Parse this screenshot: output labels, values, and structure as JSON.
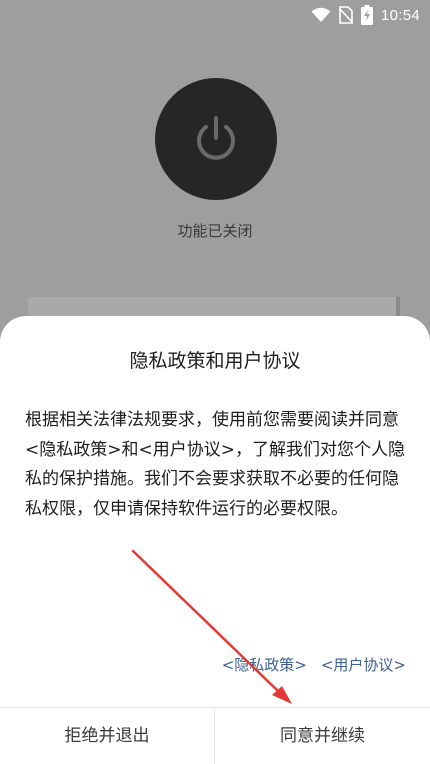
{
  "status_bar": {
    "time": "10:54"
  },
  "app": {
    "status_text": "功能已关闭",
    "icons": {
      "power": "power-icon"
    }
  },
  "dialog": {
    "title": "隐私政策和用户协议",
    "body_part1": "根据相关法律法规要求，使用前您需要阅读并同意",
    "privacy_link": "<隐私政策>",
    "body_and": "和",
    "terms_link": "<用户协议>",
    "body_part2": "，了解我们对您个人隐私的保护措施。我们不会要求获取不必要的任何隐私权限，仅申请保持软件运行的必要权限。",
    "links": {
      "privacy": "<隐私政策>",
      "terms": "<用户协议>"
    },
    "reject_label": "拒绝并退出",
    "accept_label": "同意并继续"
  },
  "colors": {
    "overlay": "#9e9e9e",
    "link": "#3f5f8f",
    "annotation_arrow": "#e53935"
  }
}
